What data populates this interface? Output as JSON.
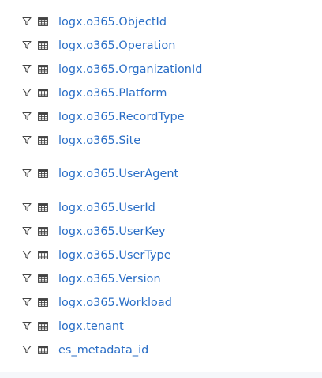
{
  "field_list": {
    "accent_color": "#2a6ec6",
    "icon_color": "#444444",
    "items": [
      {
        "label": "logx.o365.ObjectId",
        "filter_icon": "filter-icon",
        "type_icon": "table-icon"
      },
      {
        "label": "logx.o365.Operation",
        "filter_icon": "filter-icon",
        "type_icon": "table-icon"
      },
      {
        "label": "logx.o365.OrganizationId",
        "filter_icon": "filter-icon",
        "type_icon": "table-icon"
      },
      {
        "label": "logx.o365.Platform",
        "filter_icon": "filter-icon",
        "type_icon": "table-icon"
      },
      {
        "label": "logx.o365.RecordType",
        "filter_icon": "filter-icon",
        "type_icon": "table-icon"
      },
      {
        "label": "logx.o365.Site",
        "filter_icon": "filter-icon",
        "type_icon": "table-icon"
      },
      {
        "label": "logx.o365.UserAgent",
        "filter_icon": "filter-icon",
        "type_icon": "table-icon"
      },
      {
        "label": "logx.o365.UserId",
        "filter_icon": "filter-icon",
        "type_icon": "table-icon"
      },
      {
        "label": "logx.o365.UserKey",
        "filter_icon": "filter-icon",
        "type_icon": "table-icon"
      },
      {
        "label": "logx.o365.UserType",
        "filter_icon": "filter-icon",
        "type_icon": "table-icon"
      },
      {
        "label": "logx.o365.Version",
        "filter_icon": "filter-icon",
        "type_icon": "table-icon"
      },
      {
        "label": "logx.o365.Workload",
        "filter_icon": "filter-icon",
        "type_icon": "table-icon"
      },
      {
        "label": "logx.tenant",
        "filter_icon": "filter-icon",
        "type_icon": "table-icon"
      },
      {
        "label": "es_metadata_id",
        "filter_icon": "filter-icon",
        "type_icon": "table-icon"
      }
    ]
  }
}
